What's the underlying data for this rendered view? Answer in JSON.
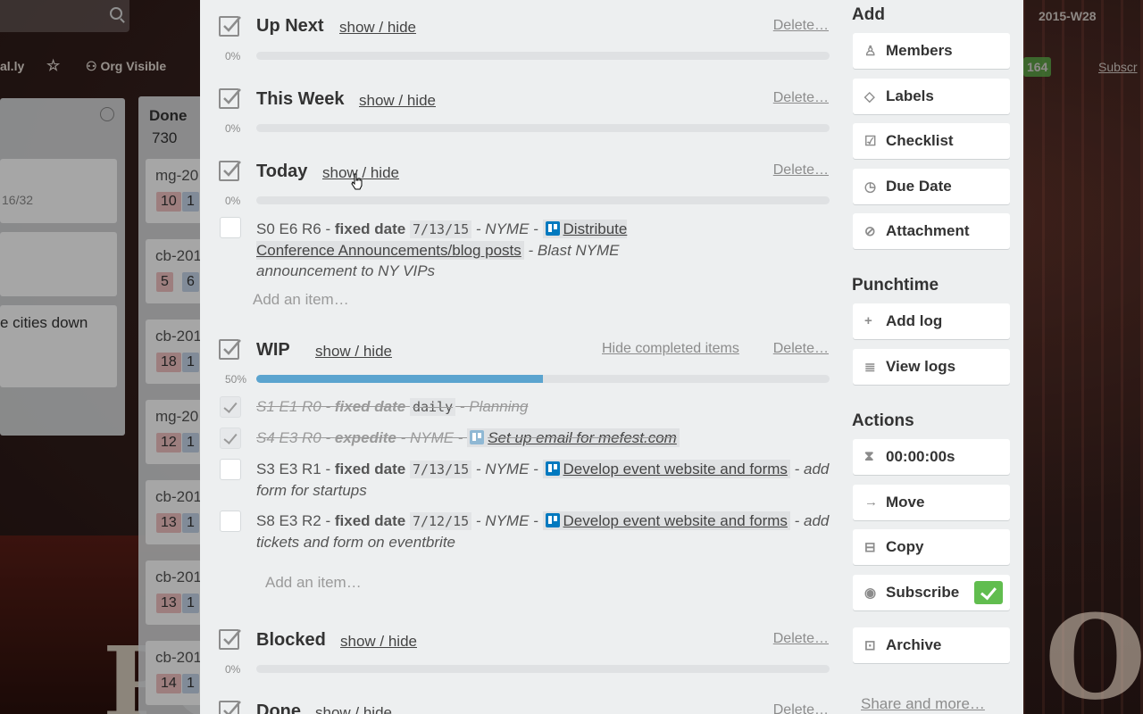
{
  "board": {
    "header_left": "al.ly",
    "org_visible": "Org Visible",
    "top_right_week": "2015-W28",
    "top_right_count": "164",
    "top_right_subscribe": "Subscr",
    "list_left": {
      "card1_meta": "16/32",
      "card3_text": "e cities down"
    },
    "list_done": {
      "title": "Done",
      "count": "730",
      "card_prefixes": [
        "mg-20",
        "cb-201",
        "cb-201",
        "mg-20",
        "cb-201",
        "cb-201",
        "cb-201"
      ],
      "card_numbers": [
        [
          "10",
          "1"
        ],
        [
          "5",
          "6"
        ],
        [
          "18",
          "1"
        ],
        [
          "12",
          "1"
        ],
        [
          "13",
          "1"
        ],
        [
          "13",
          "1"
        ],
        [
          "14",
          "1"
        ]
      ]
    },
    "poster_text": "PO"
  },
  "checklists": [
    {
      "title": "Up Next",
      "toggle": "show / hide",
      "delete": "Delete…",
      "percent": "0%",
      "progress": 0
    },
    {
      "title": "This Week",
      "toggle": "show / hide",
      "delete": "Delete…",
      "percent": "0%",
      "progress": 0
    },
    {
      "title": "Today",
      "toggle": "show / hide",
      "delete": "Delete…",
      "percent": "0%",
      "progress": 0,
      "add_item": "Add an item…"
    },
    {
      "title": "WIP",
      "toggle": "show / hide",
      "hide_completed": "Hide completed items",
      "delete": "Delete…",
      "percent": "50%",
      "progress": 0.5,
      "add_item": "Add an item…"
    },
    {
      "title": "Blocked",
      "toggle": "show / hide",
      "delete": "Delete…",
      "percent": "0%",
      "progress": 0
    },
    {
      "title": "Done",
      "toggle": "show / hide",
      "delete": "Delete…"
    }
  ],
  "items": {
    "today_1": {
      "pre": "S0 E6 R6 - ",
      "bold": "fixed date",
      "date": "7/13/15",
      "mid": " - NYME - ",
      "link": "Distribute Conference Announcements/blog posts",
      "post": " - Blast NYME announcement to NY VIPs"
    },
    "wip_1": {
      "pre": "S1 E1 R0 - ",
      "bold": "fixed date",
      "date": "daily",
      "post": " - Planning"
    },
    "wip_2": {
      "pre": "S4 E3 R0 - ",
      "bold": "expedite",
      "mid": " - NYME - ",
      "link": "Set up email for mefest.com"
    },
    "wip_3": {
      "pre": "S3 E3 R1 - ",
      "bold": "fixed date",
      "date": "7/13/15",
      "mid": " - NYME - ",
      "link": "Develop event website and forms",
      "post": " - add form for startups"
    },
    "wip_4": {
      "pre": "S8 E3 R2 - ",
      "bold": "fixed date",
      "date": "7/12/15",
      "mid": " - NYME - ",
      "link": "Develop event website and forms",
      "post": " - add tickets and form on eventbrite"
    }
  },
  "sidebar": {
    "add_heading": "Add",
    "add_buttons": [
      {
        "label": "Members",
        "icon": "person-icon"
      },
      {
        "label": "Labels",
        "icon": "tag-icon"
      },
      {
        "label": "Checklist",
        "icon": "checkbox-icon"
      },
      {
        "label": "Due Date",
        "icon": "clock-icon"
      },
      {
        "label": "Attachment",
        "icon": "paperclip-icon"
      }
    ],
    "punchtime_heading": "Punchtime",
    "punchtime_buttons": [
      {
        "label": "Add log",
        "icon": "plus-icon"
      },
      {
        "label": "View logs",
        "icon": "list-icon"
      }
    ],
    "actions_heading": "Actions",
    "action_buttons": [
      {
        "label": "00:00:00s",
        "icon": "hourglass-icon"
      },
      {
        "label": "Move",
        "icon": "arrow-right-icon"
      },
      {
        "label": "Copy",
        "icon": "copy-icon"
      },
      {
        "label": "Subscribe",
        "icon": "eye-icon",
        "checked": true
      },
      {
        "label": "Archive",
        "icon": "archive-icon"
      }
    ],
    "share": "Share and more…"
  },
  "colors": {
    "progress": "#5ba4cf",
    "subscribe_check": "#61bd4f",
    "trello_blue": "#0079bf"
  }
}
